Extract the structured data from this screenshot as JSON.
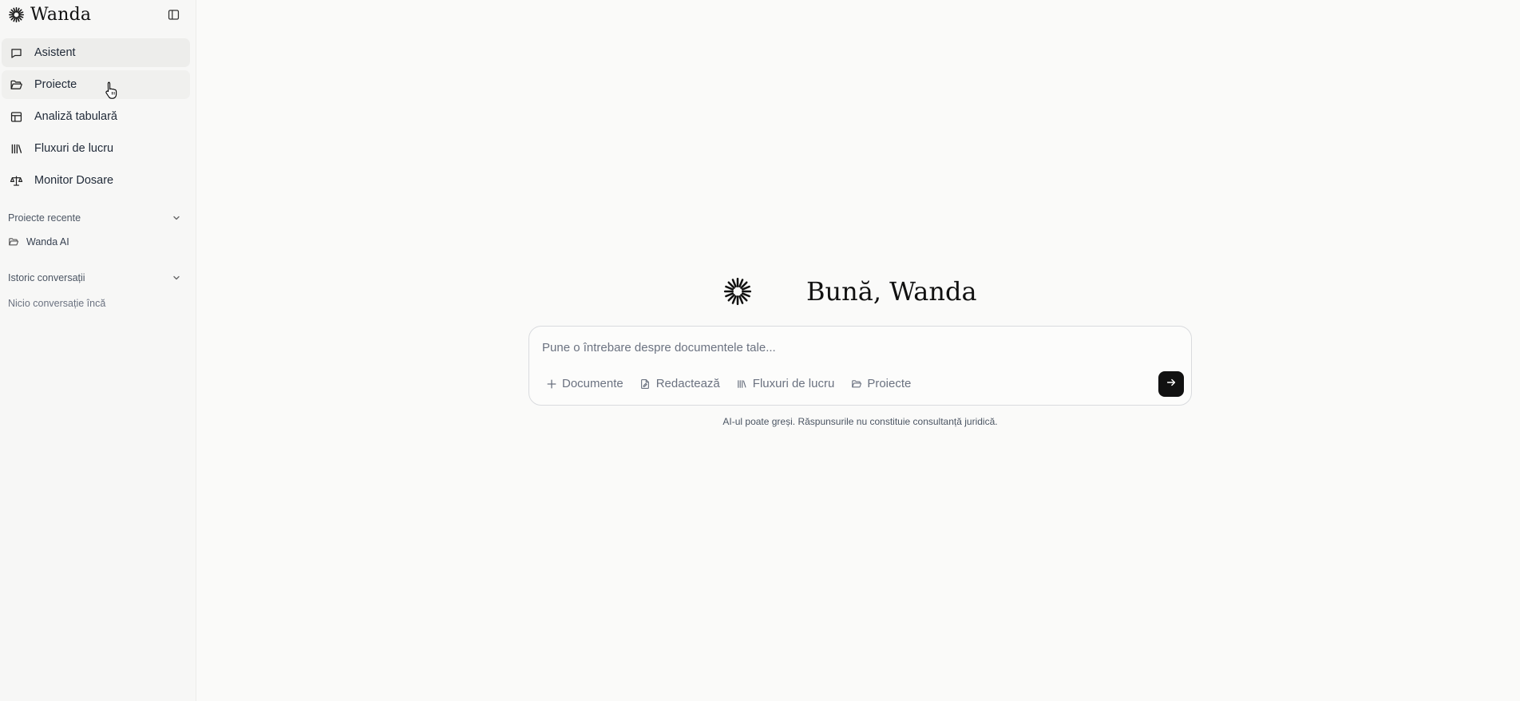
{
  "brand": {
    "name": "Wanda",
    "logo_icon": "sparkle-burst-icon"
  },
  "sidebar": {
    "toggle_icon": "sidebar-toggle-icon",
    "nav": [
      {
        "label": "Asistent",
        "icon": "chat-bubble-icon",
        "state": "active"
      },
      {
        "label": "Proiecte",
        "icon": "folder-open-icon",
        "state": "hover"
      },
      {
        "label": "Analiză tabulară",
        "icon": "table-icon",
        "state": ""
      },
      {
        "label": "Fluxuri de lucru",
        "icon": "library-icon",
        "state": ""
      },
      {
        "label": "Monitor Dosare",
        "icon": "scale-icon",
        "state": ""
      }
    ],
    "recent_projects": {
      "title": "Proiecte recente",
      "items": [
        {
          "label": "Wanda AI",
          "icon": "folder-open-icon"
        }
      ]
    },
    "history": {
      "title": "Istoric conversații",
      "empty_text": "Nicio conversație încă"
    }
  },
  "main": {
    "greeting": "Bună, Wanda",
    "composer": {
      "placeholder": "Pune o întrebare despre documentele tale...",
      "value": "",
      "tools": [
        {
          "label": "Documente",
          "icon": "plus-icon"
        },
        {
          "label": "Redactează",
          "icon": "document-edit-icon"
        },
        {
          "label": "Fluxuri de lucru",
          "icon": "library-icon"
        },
        {
          "label": "Proiecte",
          "icon": "folder-open-icon"
        }
      ],
      "send_icon": "arrow-right-icon"
    },
    "disclaimer": "AI-ul poate greși. Răspunsurile nu constituie consultanță juridică."
  },
  "colors": {
    "send_button": "#111111",
    "active_nav": "#ededeb",
    "background": "#fafaf9"
  }
}
